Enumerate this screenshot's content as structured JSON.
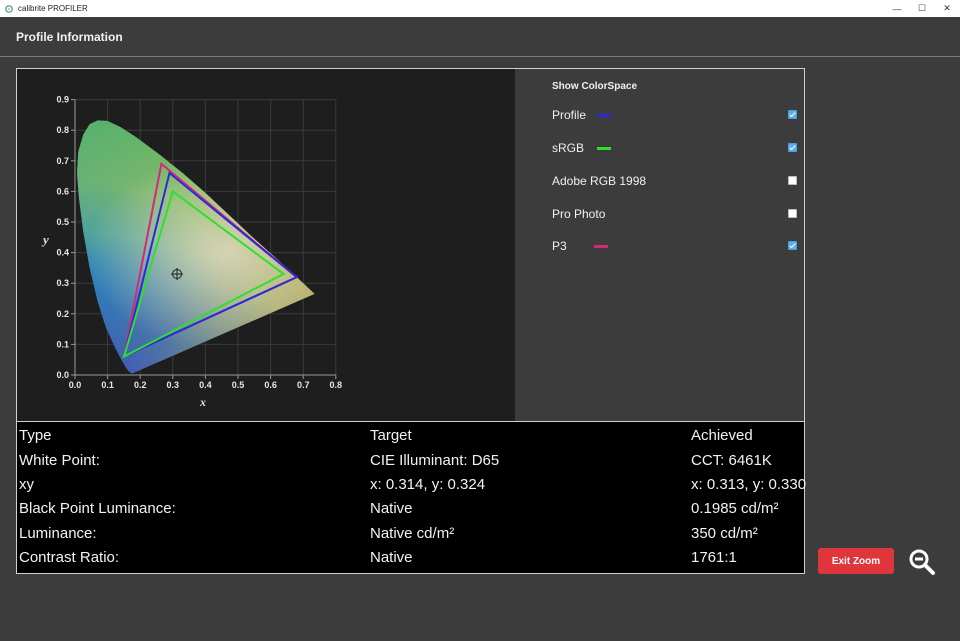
{
  "window": {
    "title": "calibrite PROFILER",
    "minimize": "—",
    "maximize": "☐",
    "close": "✕"
  },
  "header": {
    "title": "Profile Information"
  },
  "plot": {
    "x_label": "x",
    "y_label": "y",
    "x_ticks": [
      "0.0",
      "0.1",
      "0.2",
      "0.3",
      "0.4",
      "0.5",
      "0.6",
      "0.7",
      "0.8"
    ],
    "y_ticks": [
      "0.0",
      "0.1",
      "0.2",
      "0.3",
      "0.4",
      "0.5",
      "0.6",
      "0.7",
      "0.8",
      "0.9"
    ],
    "white_point": {
      "x": 0.313,
      "y": 0.33
    },
    "gamuts": {
      "profile": {
        "color": "#2b2bd6",
        "points": [
          [
            0.68,
            0.32
          ],
          [
            0.29,
            0.66
          ],
          [
            0.15,
            0.06
          ]
        ]
      },
      "srgb": {
        "color": "#2ee02e",
        "points": [
          [
            0.64,
            0.33
          ],
          [
            0.3,
            0.6
          ],
          [
            0.15,
            0.06
          ]
        ]
      },
      "p3": {
        "color": "#d6287a",
        "points": [
          [
            0.68,
            0.32
          ],
          [
            0.265,
            0.69
          ],
          [
            0.15,
            0.06
          ]
        ]
      }
    }
  },
  "legend": {
    "heading": "Show ColorSpace",
    "items": [
      {
        "label": "Profile",
        "color": "#2b2bd6",
        "checked": true
      },
      {
        "label": "sRGB",
        "color": "#2ee02e",
        "checked": true
      },
      {
        "label": "Adobe RGB 1998",
        "color": "",
        "checked": false
      },
      {
        "label": "Pro Photo",
        "color": "",
        "checked": false
      },
      {
        "label": "P3",
        "color": "#d6287a",
        "checked": true
      }
    ]
  },
  "table": {
    "rows": [
      [
        "Type",
        "Target",
        "Achieved"
      ],
      [
        "White Point:",
        "CIE Illuminant: D65",
        "CCT: 6461K"
      ],
      [
        "xy",
        "x: 0.314, y: 0.324",
        "x: 0.313, y: 0.330"
      ],
      [
        "Black Point Luminance:",
        "Native",
        "0.1985 cd/m²"
      ],
      [
        "Luminance:",
        "Native cd/m²",
        "350 cd/m²"
      ],
      [
        "Contrast Ratio:",
        "Native",
        "1761:1"
      ]
    ]
  },
  "actions": {
    "exit_zoom": "Exit Zoom"
  }
}
